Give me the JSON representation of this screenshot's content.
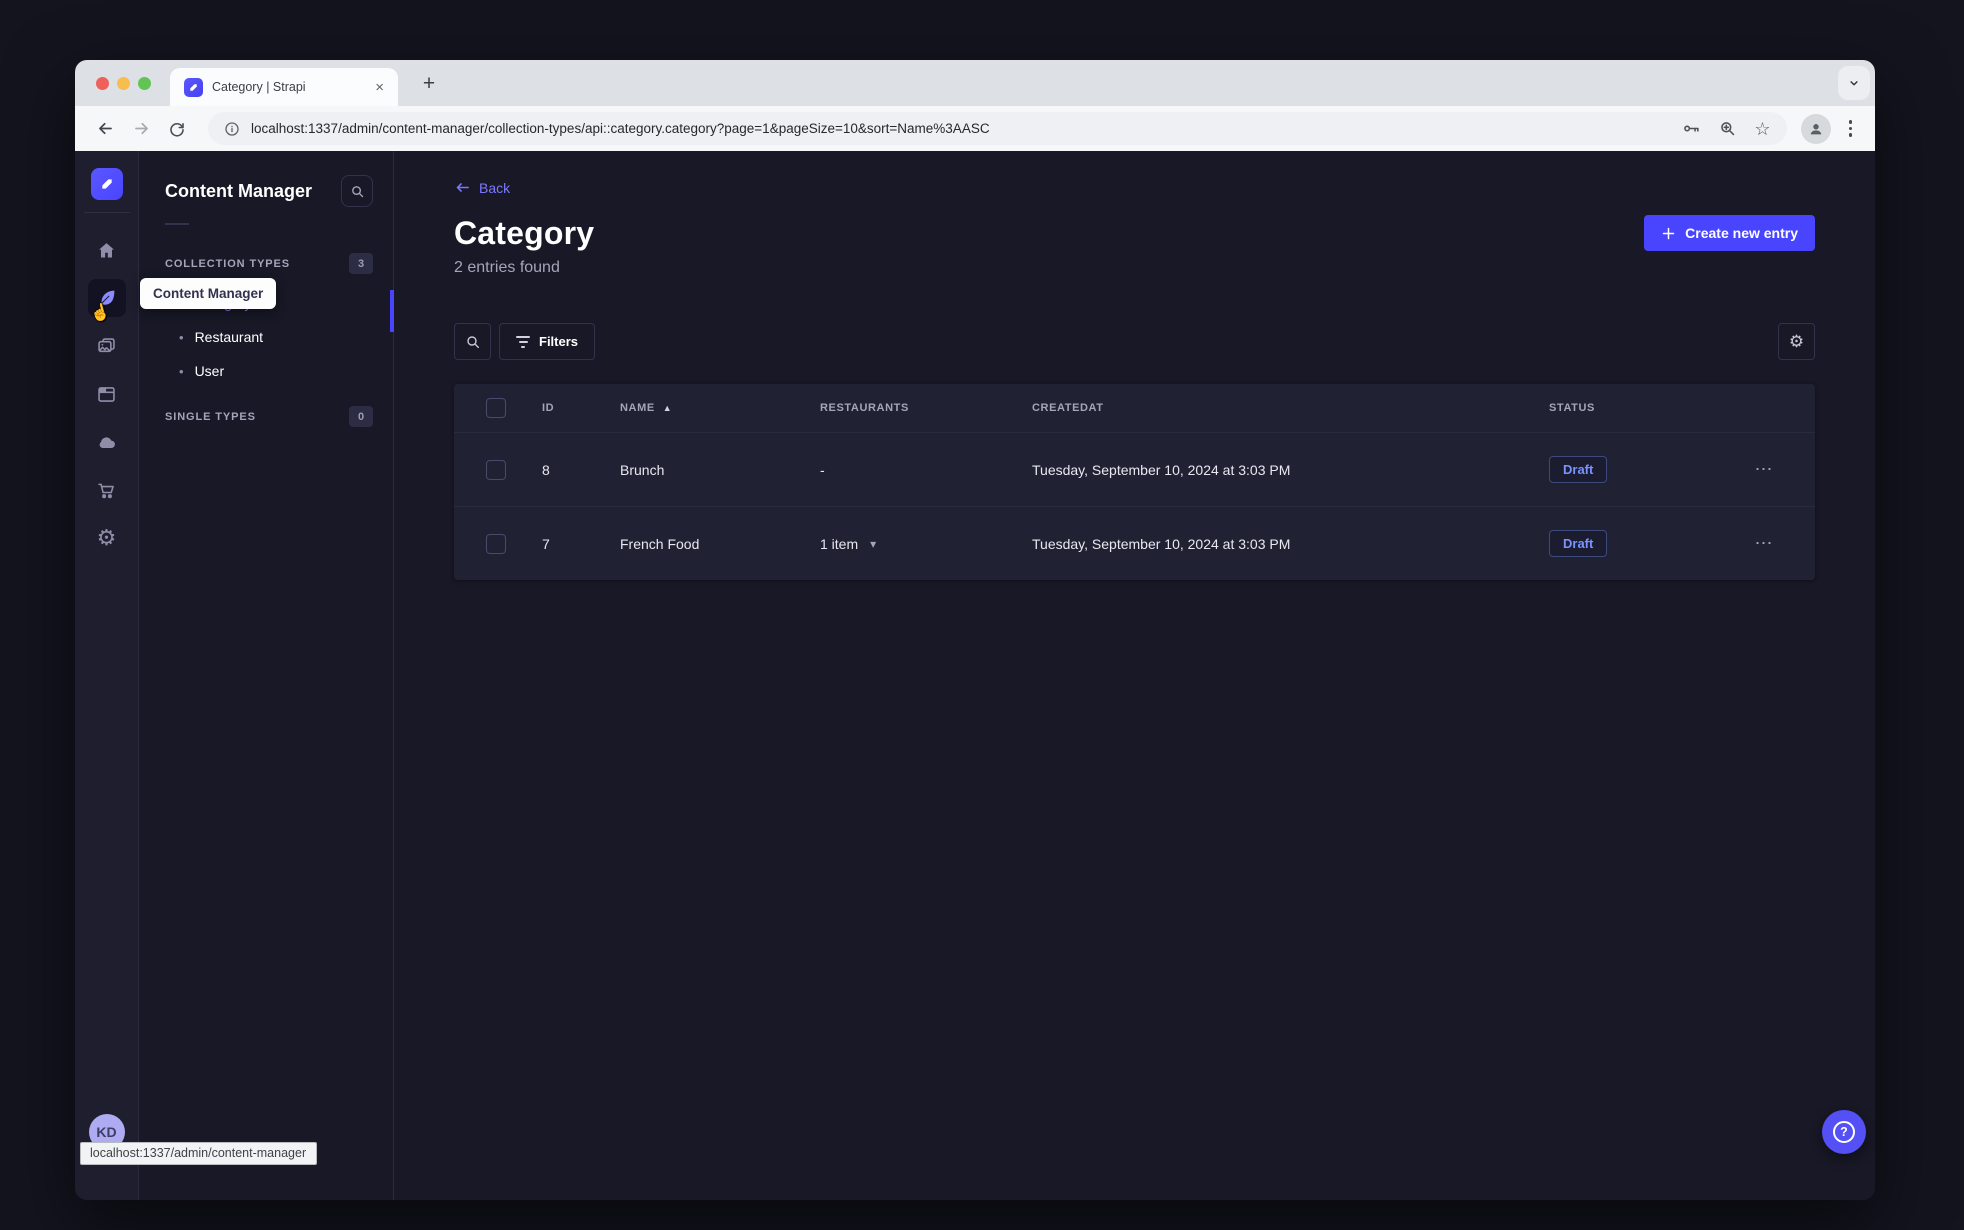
{
  "browser": {
    "tab": {
      "title": "Category | Strapi",
      "close_glyph": "×"
    },
    "new_tab_glyph": "+",
    "url": "localhost:1337/admin/content-manager/collection-types/api::category.category?page=1&pageSize=10&sort=Name%3AASC",
    "status_tooltip": "localhost:1337/admin/content-manager"
  },
  "colors": {
    "primary": "#4945ff",
    "accent_text": "#7b79ff",
    "draft_text": "#7b93ff",
    "page_bg": "#181826",
    "card_bg": "#212134"
  },
  "icons": {
    "gear_glyph": "⚙",
    "star_glyph": "☆",
    "sort_asc_glyph": "▲",
    "caret_down_glyph": "▾",
    "ellipsis_glyph": "⋯",
    "bullet_glyph": "•",
    "cursor_hand_glyph": "☝",
    "help_glyph": "?"
  },
  "mainnav": {
    "avatar_initials": "KD"
  },
  "subnav": {
    "title": "Content Manager",
    "tooltip": "Content Manager",
    "collection_types": {
      "label": "COLLECTION TYPES",
      "badge": "3",
      "items": [
        {
          "label": "Category"
        },
        {
          "label": "Restaurant"
        },
        {
          "label": "User"
        }
      ]
    },
    "single_types": {
      "label": "SINGLE TYPES",
      "badge": "0"
    }
  },
  "header": {
    "back": "Back",
    "title": "Category",
    "subtitle": "2 entries found",
    "create": "Create new entry"
  },
  "toolbar": {
    "filters": "Filters"
  },
  "table": {
    "headers": {
      "id": "ID",
      "name": "NAME",
      "restaurants": "RESTAURANTS",
      "createdat": "CREATEDAT",
      "status": "STATUS"
    },
    "rows": [
      {
        "id": "8",
        "name": "Brunch",
        "restaurants": "-",
        "createdat": "Tuesday, September 10, 2024 at 3:03 PM",
        "status": "Draft"
      },
      {
        "id": "7",
        "name": "French Food",
        "restaurants": "1 item",
        "createdat": "Tuesday, September 10, 2024 at 3:03 PM",
        "status": "Draft"
      }
    ]
  }
}
